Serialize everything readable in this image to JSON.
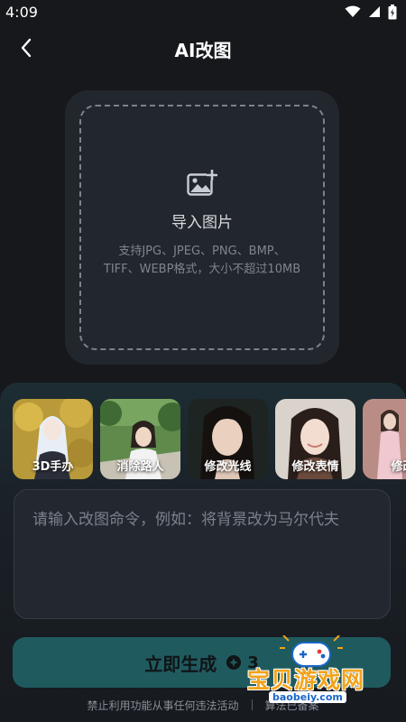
{
  "status": {
    "time": "4:09"
  },
  "header": {
    "title": "AI改图"
  },
  "upload": {
    "title": "导入图片",
    "hint": "支持JPG、JPEG、PNG、BMP、TIFF、WEBP格式，大小不超过10MB"
  },
  "presets": [
    {
      "label": "3D手办"
    },
    {
      "label": "消除路人"
    },
    {
      "label": "修改光线"
    },
    {
      "label": "修改表情"
    },
    {
      "label": "修改"
    }
  ],
  "prompt": {
    "placeholder": "请输入改图命令，例如：将背景改为马尔代夫",
    "value": ""
  },
  "generate": {
    "label": "立即生成",
    "cost": "3"
  },
  "footer": {
    "notice": "禁止利用功能从事任何违法活动",
    "right_text": "算法已备案"
  },
  "watermark": {
    "name": "宝贝游戏网",
    "url": "baobeiy.com"
  },
  "colors": {
    "background": "#16181c",
    "accent": "#1f5a5e",
    "watermark": "#f2a31b"
  }
}
